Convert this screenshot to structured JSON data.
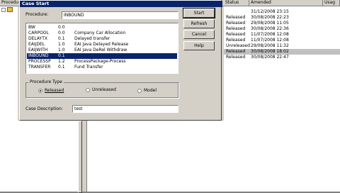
{
  "background": {
    "header": {
      "procedure": "Procedu",
      "status": "Status",
      "amended": "Amended",
      "usage": "Usag"
    },
    "rows": [
      {
        "status": "",
        "amended": "31/12/2008 23:15",
        "selected": false
      },
      {
        "status": "Released",
        "amended": "30/08/2008 22:23",
        "selected": false
      },
      {
        "status": "Released",
        "amended": "29/08/2008 11:05",
        "selected": false
      },
      {
        "status": "Released",
        "amended": "30/08/2008 22:36",
        "selected": false
      },
      {
        "status": "Released",
        "amended": "11/07/2008 12:08",
        "selected": false
      },
      {
        "status": "Released",
        "amended": "11/07/2008 12:08",
        "selected": false
      },
      {
        "status": "Unreleased",
        "amended": "29/08/2008 11:32",
        "selected": false
      },
      {
        "status": "Released",
        "amended": "30/08/2008 18:02",
        "selected": true
      },
      {
        "status": "Released",
        "amended": "30/08/2008 22:47",
        "selected": false
      }
    ]
  },
  "dialog": {
    "title": "Case Start",
    "procedure_label": "Procedure:",
    "procedure_value": "INBOUND",
    "procedures": [
      {
        "name": "BW",
        "version": "0.0",
        "description": "",
        "selected": false
      },
      {
        "name": "CARPOOL",
        "version": "0.0",
        "description": "Company Car Allocation",
        "selected": false
      },
      {
        "name": "DELAYTX",
        "version": "0.1",
        "description": "Delayed transfer",
        "selected": false
      },
      {
        "name": "EAIJDEL",
        "version": "1.0",
        "description": "EAI Java Delayed Release",
        "selected": false
      },
      {
        "name": "EAIJWITH",
        "version": "1.0",
        "description": "EAI Java DeRel Withdraw",
        "selected": false
      },
      {
        "name": "INBOUND",
        "version": "0.1",
        "description": "",
        "selected": true
      },
      {
        "name": "PROCESSP",
        "version": "1.2",
        "description": "ProcessPackage-Process",
        "selected": false
      },
      {
        "name": "TRANSFER",
        "version": "0.1",
        "description": "Fund Transfer",
        "selected": false
      }
    ],
    "buttons": {
      "start": "Start",
      "refresh": "Refresh",
      "cancel": "Cancel",
      "help": "Help"
    },
    "procedure_type": {
      "title": "Procedure Type",
      "released": "Released",
      "unreleased": "Unreleased",
      "model": "Model",
      "selected": "released"
    },
    "case_description_label": "Case Description:",
    "case_description_value": "test"
  }
}
